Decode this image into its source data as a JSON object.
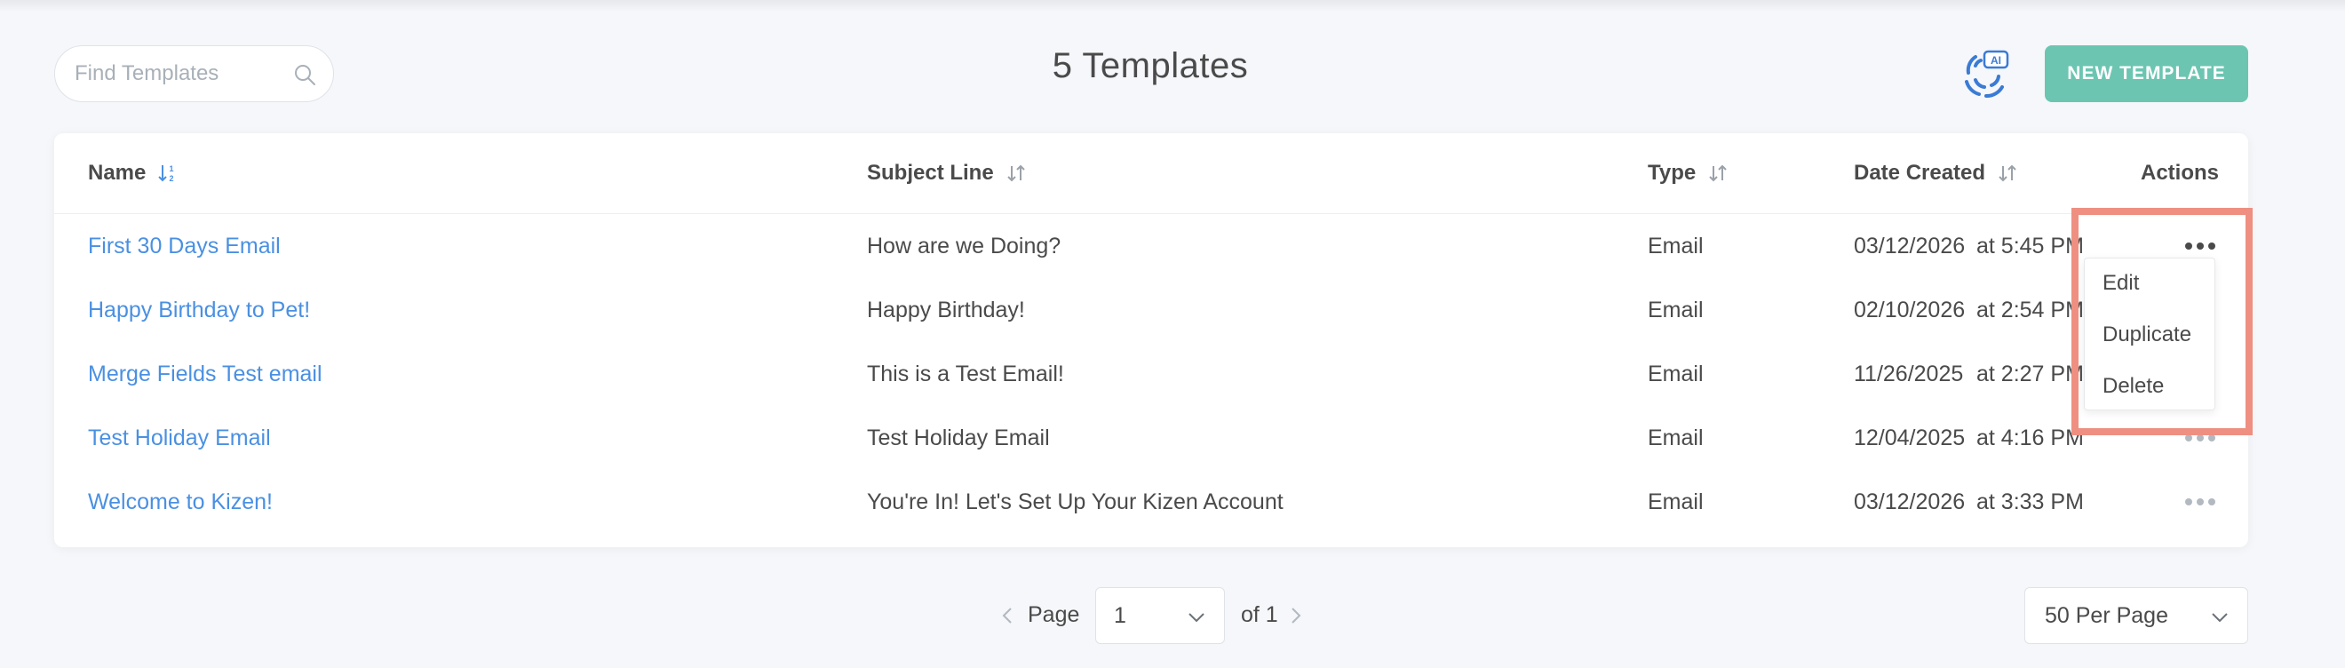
{
  "search": {
    "placeholder": "Find Templates",
    "value": ""
  },
  "header": {
    "title": "5 Templates",
    "new_template_label": "NEW TEMPLATE"
  },
  "table": {
    "columns": {
      "name": "Name",
      "subject": "Subject Line",
      "type": "Type",
      "date": "Date Created",
      "actions": "Actions"
    },
    "rows": [
      {
        "name": "First 30 Days Email",
        "subject": "How are we Doing?",
        "type": "Email",
        "date": "03/12/2026",
        "time": "at  5:45 PM"
      },
      {
        "name": "Happy Birthday to Pet!",
        "subject": "Happy Birthday!",
        "type": "Email",
        "date": "02/10/2026",
        "time": "at  2:54 PM"
      },
      {
        "name": "Merge Fields Test email",
        "subject": "This is a Test Email!",
        "type": "Email",
        "date": "11/26/2025",
        "time": "at  2:27 PM"
      },
      {
        "name": "Test Holiday Email",
        "subject": "Test Holiday Email",
        "type": "Email",
        "date": "12/04/2025",
        "time": "at  4:16 PM"
      },
      {
        "name": "Welcome to Kizen!",
        "subject": "You're In! Let's Set Up Your Kizen Account",
        "type": "Email",
        "date": "03/12/2026",
        "time": "at  3:33 PM"
      }
    ]
  },
  "actions_menu": {
    "items": [
      "Edit",
      "Duplicate",
      "Delete"
    ]
  },
  "pagination": {
    "page_label": "Page",
    "current_page": "1",
    "of_label": "of 1",
    "per_page": "50 Per Page"
  },
  "colors": {
    "accent": "#6cc5b1",
    "link": "#4a90e2",
    "highlight": "#ee8f82"
  }
}
